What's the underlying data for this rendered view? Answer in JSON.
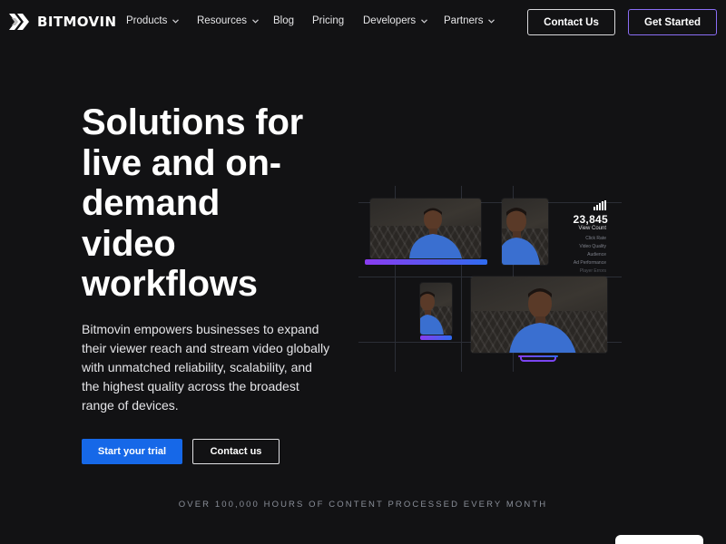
{
  "brand": {
    "name": "BITMOVIN",
    "logo_icon": "chevrons-logo-icon"
  },
  "nav": {
    "items": [
      {
        "label": "Products",
        "dropdown": true
      },
      {
        "label": "Resources",
        "dropdown": true
      },
      {
        "label": "Blog",
        "dropdown": false
      },
      {
        "label": "Pricing",
        "dropdown": false
      },
      {
        "label": "Developers",
        "dropdown": true
      },
      {
        "label": "Partners",
        "dropdown": true
      }
    ],
    "contact_label": "Contact Us",
    "start_label": "Get Started"
  },
  "hero": {
    "title_lines": [
      "Solutions for",
      "live and on-",
      "demand",
      "video",
      "workflows"
    ],
    "description": "Bitmovin empowers businesses to expand their viewer reach and stream video globally with unmatched reliability, scalability, and the highest quality across the broadest range of devices.",
    "primary_cta": "Start your trial",
    "secondary_cta": "Contact us"
  },
  "graphic": {
    "stat_value": "23,845",
    "stat_label": "View Count",
    "metrics": [
      "Click Rate",
      "Video Quality",
      "Audience",
      "Ad Performance",
      "Player Errors"
    ]
  },
  "tagline": "OVER 100,000 HOURS OF CONTENT PROCESSED EVERY MONTH",
  "colors": {
    "background": "#121214",
    "primary_button": "#1668e8",
    "accent_purple": "#8a6df5",
    "accent_gradient_start": "#8a3cf0",
    "accent_gradient_end": "#2f6cf0",
    "tagline_text": "#8a8f99"
  }
}
